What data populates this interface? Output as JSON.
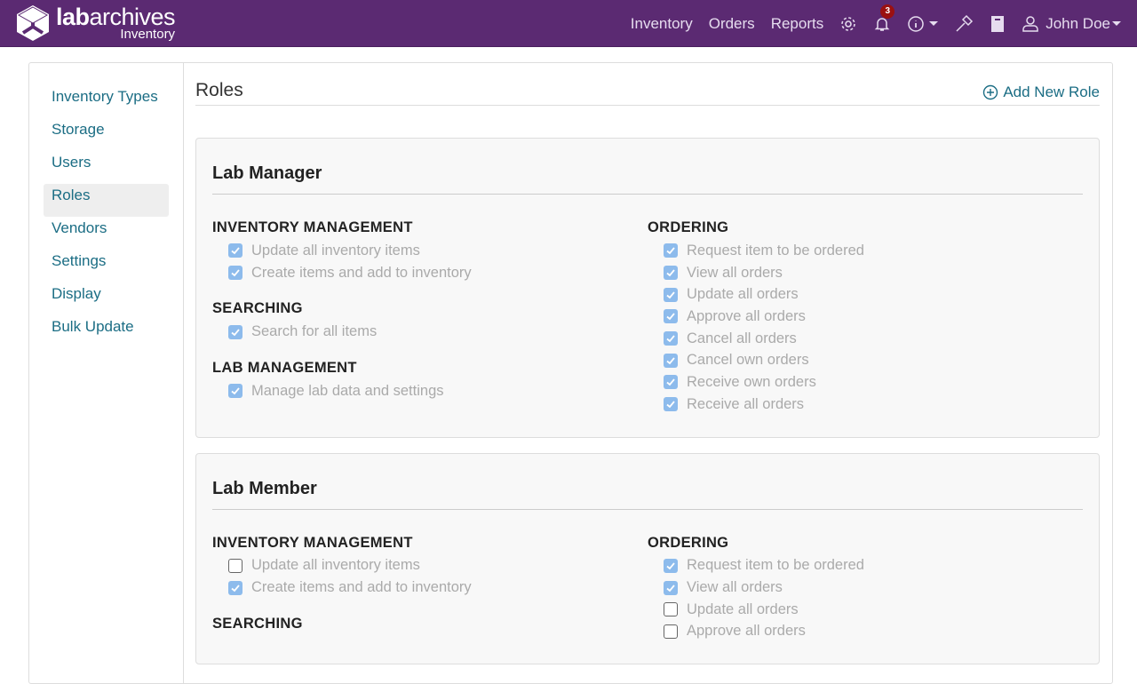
{
  "header": {
    "brand_bold": "lab",
    "brand_rest": "archives",
    "brand_sub": "Inventory",
    "nav": [
      "Inventory",
      "Orders",
      "Reports"
    ],
    "notifications_count": "3",
    "user": "John Doe"
  },
  "sidebar": {
    "items": [
      "Inventory Types",
      "Storage",
      "Users",
      "Roles",
      "Vendors",
      "Settings",
      "Display",
      "Bulk Update"
    ],
    "active": "Roles"
  },
  "main": {
    "title": "Roles",
    "add_label": "Add New Role",
    "roles": [
      {
        "name": "Lab Manager",
        "left": [
          {
            "section": "INVENTORY MANAGEMENT",
            "perms": [
              {
                "label": "Update all inventory items",
                "checked": true
              },
              {
                "label": "Create items and add to inventory",
                "checked": true
              }
            ]
          },
          {
            "section": "SEARCHING",
            "perms": [
              {
                "label": "Search for all items",
                "checked": true
              }
            ]
          },
          {
            "section": "LAB MANAGEMENT",
            "perms": [
              {
                "label": "Manage lab data and settings",
                "checked": true
              }
            ]
          }
        ],
        "right": [
          {
            "section": "ORDERING",
            "perms": [
              {
                "label": "Request item to be ordered",
                "checked": true
              },
              {
                "label": "View all orders",
                "checked": true
              },
              {
                "label": "Update all orders",
                "checked": true
              },
              {
                "label": "Approve all orders",
                "checked": true
              },
              {
                "label": "Cancel all orders",
                "checked": true
              },
              {
                "label": "Cancel own orders",
                "checked": true
              },
              {
                "label": "Receive own orders",
                "checked": true
              },
              {
                "label": "Receive all orders",
                "checked": true
              }
            ]
          }
        ]
      },
      {
        "name": "Lab Member",
        "left": [
          {
            "section": "INVENTORY MANAGEMENT",
            "perms": [
              {
                "label": "Update all inventory items",
                "checked": false
              },
              {
                "label": "Create items and add to inventory",
                "checked": true
              }
            ]
          },
          {
            "section": "SEARCHING",
            "perms": []
          }
        ],
        "right": [
          {
            "section": "ORDERING",
            "perms": [
              {
                "label": "Request item to be ordered",
                "checked": true
              },
              {
                "label": "View all orders",
                "checked": true
              },
              {
                "label": "Update all orders",
                "checked": false
              },
              {
                "label": "Approve all orders",
                "checked": false
              }
            ]
          }
        ]
      }
    ]
  }
}
